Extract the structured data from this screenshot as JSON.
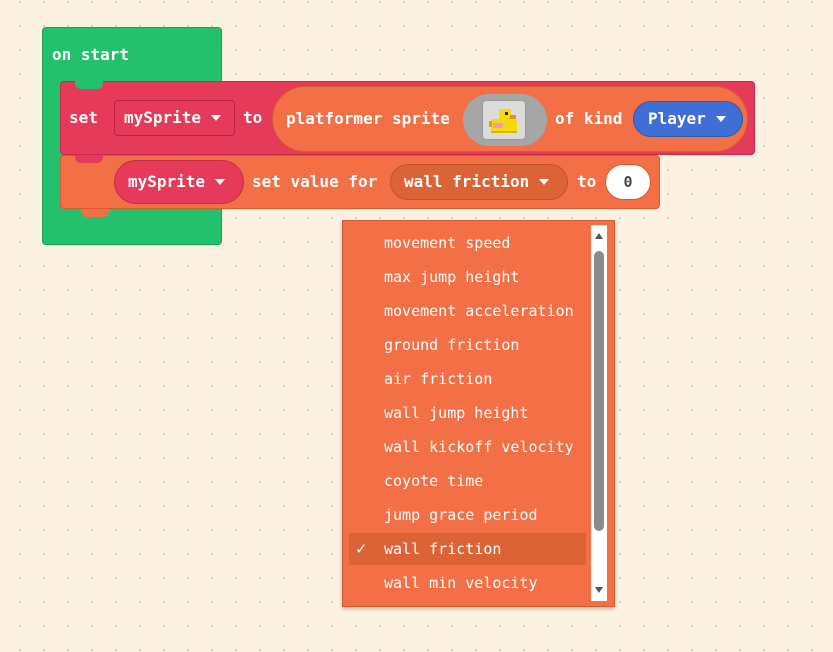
{
  "hat": {
    "label": "on start"
  },
  "set_block": {
    "set_label": "set",
    "variable": "mySprite",
    "to_label": "to",
    "constructor_label": "platformer sprite",
    "sprite_image": "duck-sprite",
    "of_kind_label": "of kind",
    "kind": "Player"
  },
  "value_block": {
    "sprite": "mySprite",
    "set_value_for_label": "set value for",
    "property": "wall friction",
    "to_label": "to",
    "value": "0"
  },
  "menu": {
    "items": [
      {
        "label": "movement speed",
        "selected": false
      },
      {
        "label": "max jump height",
        "selected": false
      },
      {
        "label": "movement acceleration",
        "selected": false
      },
      {
        "label": "ground friction",
        "selected": false
      },
      {
        "label": "air friction",
        "selected": false
      },
      {
        "label": "wall jump height",
        "selected": false
      },
      {
        "label": "wall kickoff velocity",
        "selected": false
      },
      {
        "label": "coyote time",
        "selected": false
      },
      {
        "label": "jump grace period",
        "selected": false
      },
      {
        "label": "wall friction",
        "selected": true
      },
      {
        "label": "wall min velocity",
        "selected": false
      }
    ],
    "check_mark": "✓"
  },
  "colors": {
    "events": "#23c16b",
    "variables": "#e63a5a",
    "platformer": "#f36f45",
    "kind": "#3f6fd6"
  }
}
